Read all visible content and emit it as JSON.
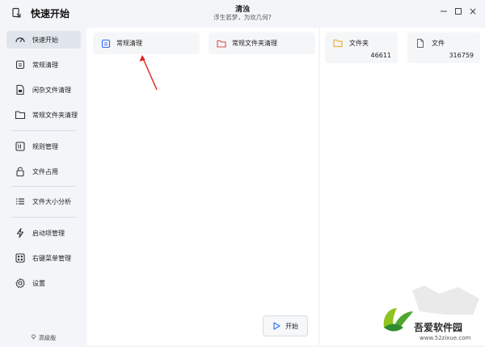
{
  "app": {
    "title": "快速开始",
    "center_title": "清浊",
    "center_subtitle": "浮生若梦，为欢几何?"
  },
  "window_controls": {
    "close": "×"
  },
  "sidebar": {
    "items": [
      {
        "label": "快速开始",
        "icon": "speedometer-icon",
        "active": true
      },
      {
        "label": "常规清理",
        "icon": "cleanup-icon"
      },
      {
        "label": "闲杂文件清理",
        "icon": "file-clean-icon"
      },
      {
        "label": "常规文件夹清理",
        "icon": "folder-icon"
      },
      {
        "label": "规则管理",
        "icon": "rules-icon"
      },
      {
        "label": "文件占用",
        "icon": "lock-icon"
      },
      {
        "label": "文件大小分析",
        "icon": "list-icon"
      },
      {
        "label": "启动项管理",
        "icon": "lightning-icon"
      },
      {
        "label": "右键菜单管理",
        "icon": "menu-grid-icon"
      },
      {
        "label": "设置",
        "icon": "gear-icon"
      }
    ],
    "version": "高级版"
  },
  "main": {
    "cards": [
      {
        "label": "常规清理",
        "icon": "cleanup-icon"
      },
      {
        "label": "常规文件夹清理",
        "icon": "folder-icon"
      }
    ],
    "start_label": "开始"
  },
  "stats": [
    {
      "label": "文件夹",
      "value": "46611",
      "icon": "folder-icon"
    },
    {
      "label": "文件",
      "value": "316759",
      "icon": "file-icon"
    }
  ],
  "watermark": {
    "text": "吾爱软件园",
    "url": "www.52zixue.com"
  },
  "colors": {
    "accent": "#2f6bff",
    "arrow": "#e02020",
    "folder": "#f0b339"
  }
}
